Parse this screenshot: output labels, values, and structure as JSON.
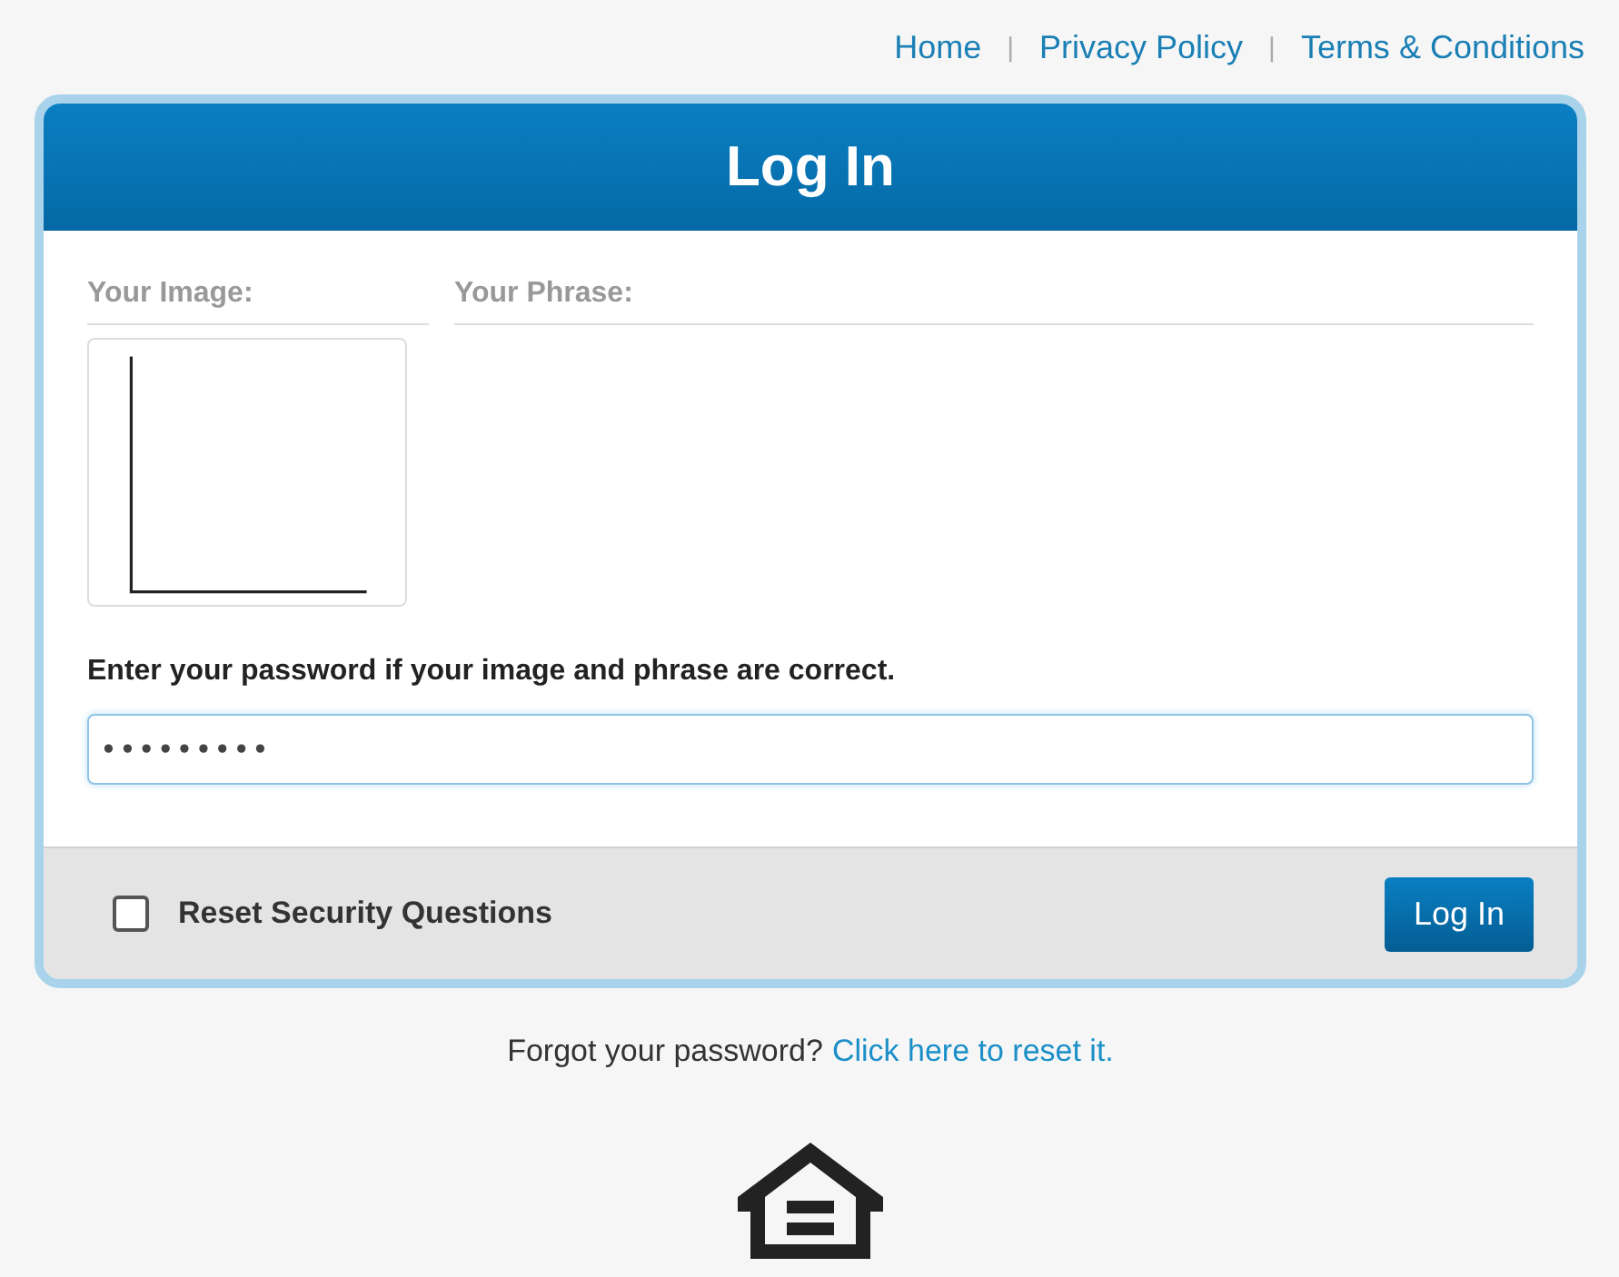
{
  "nav_links": [
    "Home",
    "Privacy Policy",
    "Terms & Conditions"
  ],
  "nav_separator": "|",
  "card": {
    "title": "Log In",
    "image_label": "Your Image:",
    "phrase_label": "Your Phrase:",
    "password_prompt": "Enter your password if your image and phrase are correct.",
    "password_value": "•••••••••",
    "reset_checkbox": {
      "label": "Reset Security Questions",
      "checked": false
    },
    "login_button": "Log In"
  },
  "forgot": {
    "text": "Forgot your password?",
    "link": "Click here to reset it."
  }
}
